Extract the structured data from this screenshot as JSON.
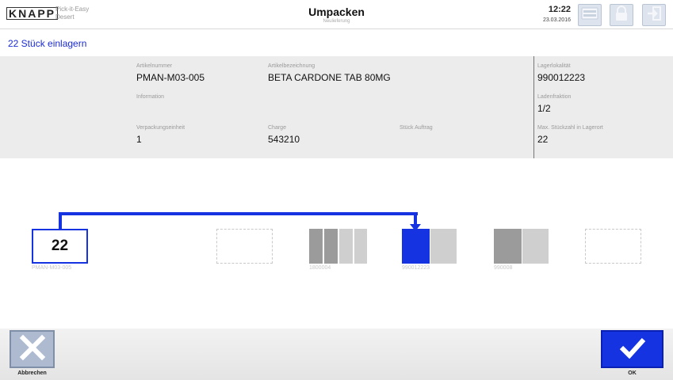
{
  "header": {
    "logo": "KNAPP",
    "app_name_line1": "Pick-it-Easy",
    "app_name_line2": "Desert",
    "title": "Umpacken",
    "subtitle": "Neulieferung",
    "time": "12:22",
    "date": "23.03.2016",
    "buttons": {
      "mobile_icon": "mobile-device-icon",
      "lock_icon": "lock-icon",
      "logout_icon": "logout-icon"
    }
  },
  "subheader": {
    "text": "22 Stück einlagern"
  },
  "info": {
    "article_number": {
      "label": "Artikelnummer",
      "value": "PMAN-M03-005"
    },
    "article_name": {
      "label": "Artikelbezeichnung",
      "value": "BETA CARDONE TAB 80MG"
    },
    "storage_location": {
      "label": "Lagerlokalität",
      "value": "990012223"
    },
    "information": {
      "label": "Information",
      "value": ""
    },
    "compartment": {
      "label": "Ladenfraktion",
      "value": "1/2"
    },
    "packaging_unit": {
      "label": "Verpackungseinheit",
      "value": "1"
    },
    "batch": {
      "label": "Charge",
      "value": "543210"
    },
    "pieces_order": {
      "label": "Stück Auftrag",
      "value": ""
    },
    "max_pieces": {
      "label": "Max. Stückzahl in Lagerort",
      "value": "22"
    }
  },
  "transfer": {
    "source_quantity": "22",
    "source_label": "PMAN-M03-005",
    "locations": [
      "1800004",
      "990012223",
      "990008"
    ],
    "colors": {
      "accent": "#1533e0",
      "gray_dark": "#9b9b9b",
      "gray_light": "#cfcfcf"
    }
  },
  "footer": {
    "cancel_label": "Abbrechen",
    "ok_label": "OK",
    "cancel_icon": "close-icon",
    "ok_icon": "checkmark-icon"
  }
}
